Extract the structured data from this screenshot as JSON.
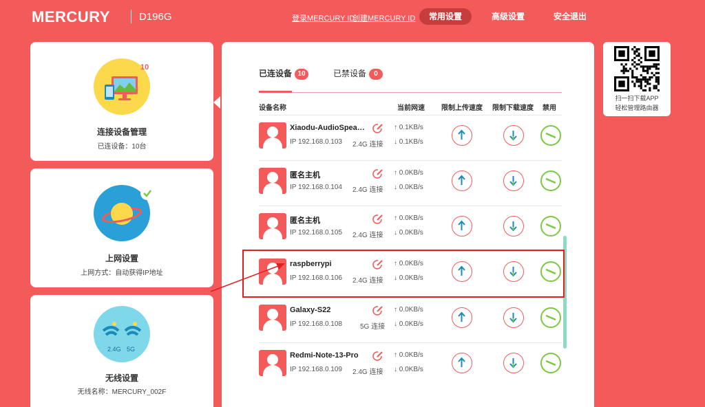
{
  "header": {
    "brand": "MERCURY",
    "model": "D196G",
    "login_link": "登录MERCURY ID",
    "create_link": "创建MERCURY ID",
    "nav": [
      "常用设置",
      "高级设置",
      "安全退出"
    ]
  },
  "cards": [
    {
      "title": "连接设备管理",
      "sub": "已连设备：10台",
      "badge": "10"
    },
    {
      "title": "上网设置",
      "sub": "上网方式：自动获得IP地址"
    },
    {
      "title": "无线设置",
      "sub": "无线名称：MERCURY_002F",
      "band_24": "2.4G",
      "band_5": "5G"
    }
  ],
  "tabs": [
    {
      "label": "已连设备",
      "count": "10"
    },
    {
      "label": "已禁设备",
      "count": "0"
    }
  ],
  "columns": {
    "name": "设备名称",
    "speed": "当前网速",
    "limit_up": "限制上传速度",
    "limit_down": "限制下载速度",
    "ban": "禁用"
  },
  "devices": [
    {
      "name": "Xiaodu-AudioSpeak...",
      "ip": "IP 192.168.0.103",
      "band": "2.4G 连接",
      "up": "↑ 0.1KB/s",
      "down": "↓ 0.1KB/s"
    },
    {
      "name": "匿名主机",
      "ip": "IP 192.168.0.104",
      "band": "2.4G 连接",
      "up": "↑ 0.0KB/s",
      "down": "↓ 0.0KB/s"
    },
    {
      "name": "匿名主机",
      "ip": "IP 192.168.0.105",
      "band": "2.4G 连接",
      "up": "↑ 0.0KB/s",
      "down": "↓ 0.0KB/s"
    },
    {
      "name": "raspberrypi",
      "ip": "IP 192.168.0.106",
      "band": "2.4G 连接",
      "up": "↑ 0.0KB/s",
      "down": "↓ 0.0KB/s"
    },
    {
      "name": "Galaxy-S22",
      "ip": "IP 192.168.0.108",
      "band": "5G 连接",
      "up": "↑ 0.0KB/s",
      "down": "↓ 0.0KB/s"
    },
    {
      "name": "Redmi-Note-13-Pro",
      "ip": "IP 192.168.0.109",
      "band": "2.4G 连接",
      "up": "↑ 0.0KB/s",
      "down": "↓ 0.0KB/s"
    }
  ],
  "qr": {
    "line1": "扫一扫下载APP",
    "line2": "轻松管理路由器"
  },
  "colors": {
    "brand_red": "#f35b5b",
    "ban_green": "#7ac943",
    "up_teal": "#1a8ab8",
    "scrollbar": "#8fd9c5",
    "annotation": "#e02020"
  }
}
